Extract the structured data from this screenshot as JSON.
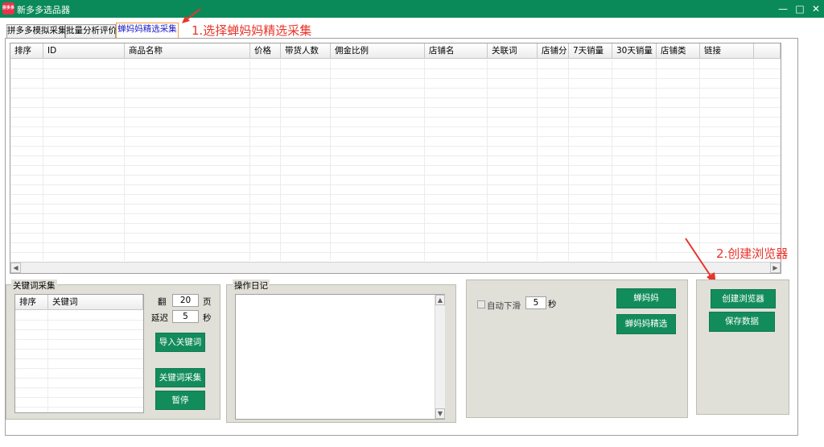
{
  "window": {
    "title": "新多多选品器",
    "icon_text": "拼多多"
  },
  "tabs": [
    {
      "label": "拼多多模拟采集"
    },
    {
      "label": "批量分析评价"
    },
    {
      "label": "蝉妈妈精选采集"
    }
  ],
  "annotations": {
    "step1": "1.选择蝉妈妈精选采集",
    "step2": "2.创建浏览器"
  },
  "grid": {
    "columns": [
      "排序",
      "ID",
      "商品名称",
      "价格",
      "带货人数",
      "佣金比例",
      "店铺名",
      "关联词",
      "店铺分",
      "7天销量",
      "30天销量",
      "店铺类",
      "链接"
    ]
  },
  "keyword_panel": {
    "title": "关键词采集",
    "columns": [
      "排序",
      "关键词"
    ],
    "pages_label": "翻",
    "pages_value": "20",
    "pages_unit": "页",
    "delay_label": "延迟",
    "delay_value": "5",
    "delay_unit": "秒",
    "import_button": "导入关键词",
    "collect_button": "关键词采集",
    "pause_button": "暂停"
  },
  "log_panel": {
    "title": "操作日记"
  },
  "chanmama_panel": {
    "autoscroll_label": "自动下滑",
    "autoscroll_value": "5",
    "autoscroll_unit": "秒",
    "chanmama_button": "蝉妈妈",
    "chanmama_selected_button": "蝉妈妈精选"
  },
  "browser_panel": {
    "create_button": "创建浏览器",
    "save_button": "保存数据"
  },
  "colors": {
    "titlebar": "#0b8a59",
    "button": "#138c5c",
    "annotation": "#e8342a"
  }
}
